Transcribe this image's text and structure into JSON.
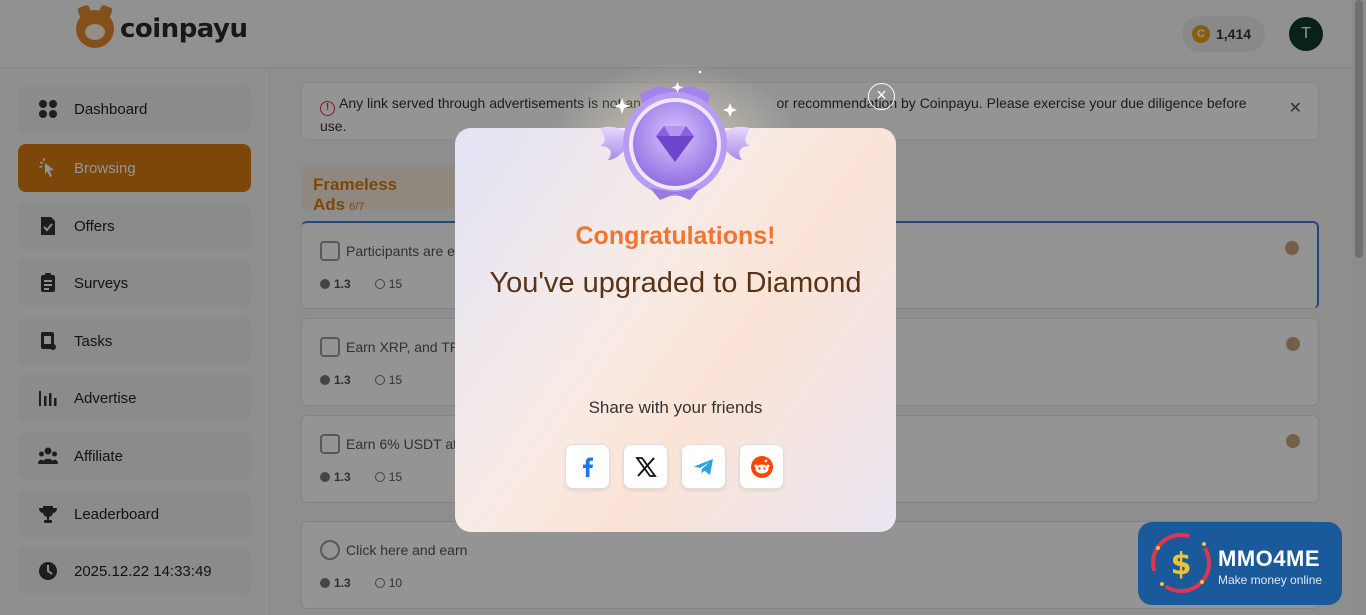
{
  "header": {
    "logo_text": "coinpayu",
    "balance": "1,414",
    "coin_symbol": "C",
    "avatar_initial": "T"
  },
  "sidebar": {
    "items": [
      {
        "label": "Dashboard",
        "icon": "dashboard-icon"
      },
      {
        "label": "Browsing",
        "icon": "cursor-click-icon",
        "active": true
      },
      {
        "label": "Offers",
        "icon": "offers-icon"
      },
      {
        "label": "Surveys",
        "icon": "surveys-icon"
      },
      {
        "label": "Tasks",
        "icon": "tasks-icon"
      },
      {
        "label": "Advertise",
        "icon": "bar-chart-icon"
      },
      {
        "label": "Affiliate",
        "icon": "users-icon"
      },
      {
        "label": "Leaderboard",
        "icon": "trophy-icon"
      },
      {
        "label": "2025.12.22 14:33:49",
        "icon": "clock-icon"
      }
    ]
  },
  "notice": {
    "text_before": "Any link served through advertisements is not an e",
    "text_after": " or recommendation by Coinpayu. Please exercise your due diligence before use."
  },
  "section": {
    "title": "Frameless Ads",
    "count": "6/7"
  },
  "ads": [
    {
      "title": "Participants are e",
      "reward": "1.3",
      "seconds": "15"
    },
    {
      "title": "Earn XRP, and TR",
      "reward": "1.3",
      "seconds": "15"
    },
    {
      "title": "Earn 6% USDT at",
      "reward": "1.3",
      "seconds": "15"
    },
    {
      "title": "Click here and earn",
      "reward": "1.3",
      "seconds": "10"
    }
  ],
  "modal": {
    "congrats": "Congratulations!",
    "upgrade": "You've upgraded to Diamond",
    "share_label": "Share with your friends",
    "share_buttons": [
      "facebook-icon",
      "x-icon",
      "telegram-icon",
      "reddit-icon"
    ],
    "close_symbol": "×"
  },
  "watermark": {
    "title": "MMO4ME",
    "subtitle": "Make money online"
  },
  "colors": {
    "accent": "#d87a12",
    "congrats": "#f07532",
    "upgrade_text": "#5a3317"
  }
}
